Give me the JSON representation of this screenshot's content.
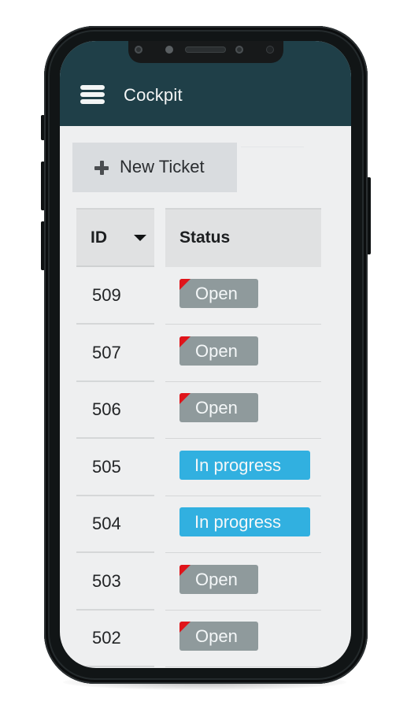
{
  "app": {
    "title": "Cockpit",
    "menu_icon": "hamburger-menu-icon"
  },
  "toolbar": {
    "new_ticket_label": "New Ticket",
    "new_ticket_icon": "plus-icon"
  },
  "table": {
    "columns": [
      {
        "label": "ID",
        "sort": "descending",
        "sort_icon": "sort-down-triangle-icon"
      },
      {
        "label": "Status"
      }
    ],
    "rows": [
      {
        "id": "509",
        "status": "Open",
        "flagged": true
      },
      {
        "id": "507",
        "status": "Open",
        "flagged": true
      },
      {
        "id": "506",
        "status": "Open",
        "flagged": true
      },
      {
        "id": "505",
        "status": "In progress",
        "flagged": false
      },
      {
        "id": "504",
        "status": "In progress",
        "flagged": false
      },
      {
        "id": "503",
        "status": "Open",
        "flagged": true
      },
      {
        "id": "502",
        "status": "Open",
        "flagged": true
      }
    ]
  },
  "colors": {
    "header_bar": "#1f3f48",
    "open_badge": "#8f9a9c",
    "in_progress_badge": "#31b0e0",
    "flag": "#e0141a",
    "new_ticket_button": "#d9dcdf"
  }
}
